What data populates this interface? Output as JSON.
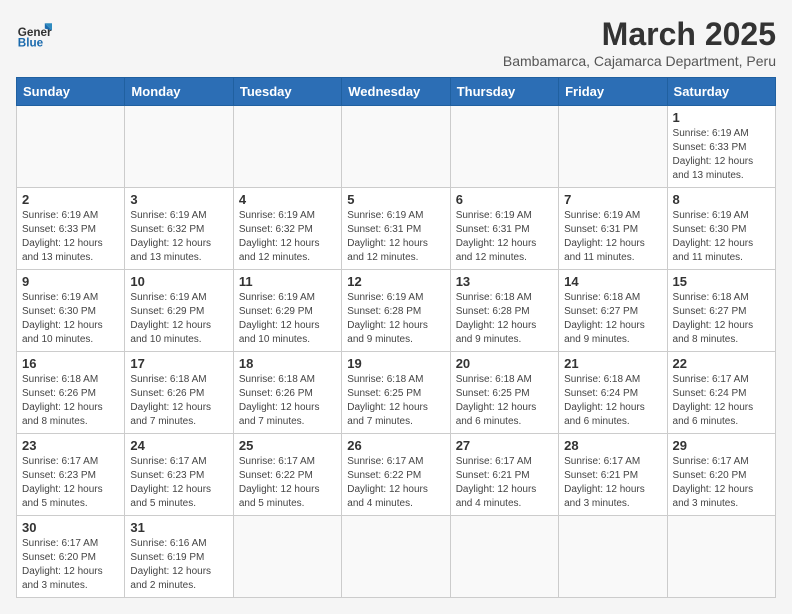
{
  "header": {
    "logo_general": "General",
    "logo_blue": "Blue",
    "month_title": "March 2025",
    "subtitle": "Bambamarca, Cajamarca Department, Peru"
  },
  "weekdays": [
    "Sunday",
    "Monday",
    "Tuesday",
    "Wednesday",
    "Thursday",
    "Friday",
    "Saturday"
  ],
  "days": [
    {
      "day": "",
      "info": ""
    },
    {
      "day": "",
      "info": ""
    },
    {
      "day": "",
      "info": ""
    },
    {
      "day": "",
      "info": ""
    },
    {
      "day": "",
      "info": ""
    },
    {
      "day": "",
      "info": ""
    },
    {
      "day": "1",
      "info": "Sunrise: 6:19 AM\nSunset: 6:33 PM\nDaylight: 12 hours and 13 minutes."
    },
    {
      "day": "2",
      "info": "Sunrise: 6:19 AM\nSunset: 6:33 PM\nDaylight: 12 hours and 13 minutes."
    },
    {
      "day": "3",
      "info": "Sunrise: 6:19 AM\nSunset: 6:32 PM\nDaylight: 12 hours and 13 minutes."
    },
    {
      "day": "4",
      "info": "Sunrise: 6:19 AM\nSunset: 6:32 PM\nDaylight: 12 hours and 12 minutes."
    },
    {
      "day": "5",
      "info": "Sunrise: 6:19 AM\nSunset: 6:31 PM\nDaylight: 12 hours and 12 minutes."
    },
    {
      "day": "6",
      "info": "Sunrise: 6:19 AM\nSunset: 6:31 PM\nDaylight: 12 hours and 12 minutes."
    },
    {
      "day": "7",
      "info": "Sunrise: 6:19 AM\nSunset: 6:31 PM\nDaylight: 12 hours and 11 minutes."
    },
    {
      "day": "8",
      "info": "Sunrise: 6:19 AM\nSunset: 6:30 PM\nDaylight: 12 hours and 11 minutes."
    },
    {
      "day": "9",
      "info": "Sunrise: 6:19 AM\nSunset: 6:30 PM\nDaylight: 12 hours and 10 minutes."
    },
    {
      "day": "10",
      "info": "Sunrise: 6:19 AM\nSunset: 6:29 PM\nDaylight: 12 hours and 10 minutes."
    },
    {
      "day": "11",
      "info": "Sunrise: 6:19 AM\nSunset: 6:29 PM\nDaylight: 12 hours and 10 minutes."
    },
    {
      "day": "12",
      "info": "Sunrise: 6:19 AM\nSunset: 6:28 PM\nDaylight: 12 hours and 9 minutes."
    },
    {
      "day": "13",
      "info": "Sunrise: 6:18 AM\nSunset: 6:28 PM\nDaylight: 12 hours and 9 minutes."
    },
    {
      "day": "14",
      "info": "Sunrise: 6:18 AM\nSunset: 6:27 PM\nDaylight: 12 hours and 9 minutes."
    },
    {
      "day": "15",
      "info": "Sunrise: 6:18 AM\nSunset: 6:27 PM\nDaylight: 12 hours and 8 minutes."
    },
    {
      "day": "16",
      "info": "Sunrise: 6:18 AM\nSunset: 6:26 PM\nDaylight: 12 hours and 8 minutes."
    },
    {
      "day": "17",
      "info": "Sunrise: 6:18 AM\nSunset: 6:26 PM\nDaylight: 12 hours and 7 minutes."
    },
    {
      "day": "18",
      "info": "Sunrise: 6:18 AM\nSunset: 6:26 PM\nDaylight: 12 hours and 7 minutes."
    },
    {
      "day": "19",
      "info": "Sunrise: 6:18 AM\nSunset: 6:25 PM\nDaylight: 12 hours and 7 minutes."
    },
    {
      "day": "20",
      "info": "Sunrise: 6:18 AM\nSunset: 6:25 PM\nDaylight: 12 hours and 6 minutes."
    },
    {
      "day": "21",
      "info": "Sunrise: 6:18 AM\nSunset: 6:24 PM\nDaylight: 12 hours and 6 minutes."
    },
    {
      "day": "22",
      "info": "Sunrise: 6:17 AM\nSunset: 6:24 PM\nDaylight: 12 hours and 6 minutes."
    },
    {
      "day": "23",
      "info": "Sunrise: 6:17 AM\nSunset: 6:23 PM\nDaylight: 12 hours and 5 minutes."
    },
    {
      "day": "24",
      "info": "Sunrise: 6:17 AM\nSunset: 6:23 PM\nDaylight: 12 hours and 5 minutes."
    },
    {
      "day": "25",
      "info": "Sunrise: 6:17 AM\nSunset: 6:22 PM\nDaylight: 12 hours and 5 minutes."
    },
    {
      "day": "26",
      "info": "Sunrise: 6:17 AM\nSunset: 6:22 PM\nDaylight: 12 hours and 4 minutes."
    },
    {
      "day": "27",
      "info": "Sunrise: 6:17 AM\nSunset: 6:21 PM\nDaylight: 12 hours and 4 minutes."
    },
    {
      "day": "28",
      "info": "Sunrise: 6:17 AM\nSunset: 6:21 PM\nDaylight: 12 hours and 3 minutes."
    },
    {
      "day": "29",
      "info": "Sunrise: 6:17 AM\nSunset: 6:20 PM\nDaylight: 12 hours and 3 minutes."
    },
    {
      "day": "30",
      "info": "Sunrise: 6:17 AM\nSunset: 6:20 PM\nDaylight: 12 hours and 3 minutes."
    },
    {
      "day": "31",
      "info": "Sunrise: 6:16 AM\nSunset: 6:19 PM\nDaylight: 12 hours and 2 minutes."
    },
    {
      "day": "",
      "info": ""
    },
    {
      "day": "",
      "info": ""
    },
    {
      "day": "",
      "info": ""
    },
    {
      "day": "",
      "info": ""
    },
    {
      "day": "",
      "info": ""
    }
  ]
}
